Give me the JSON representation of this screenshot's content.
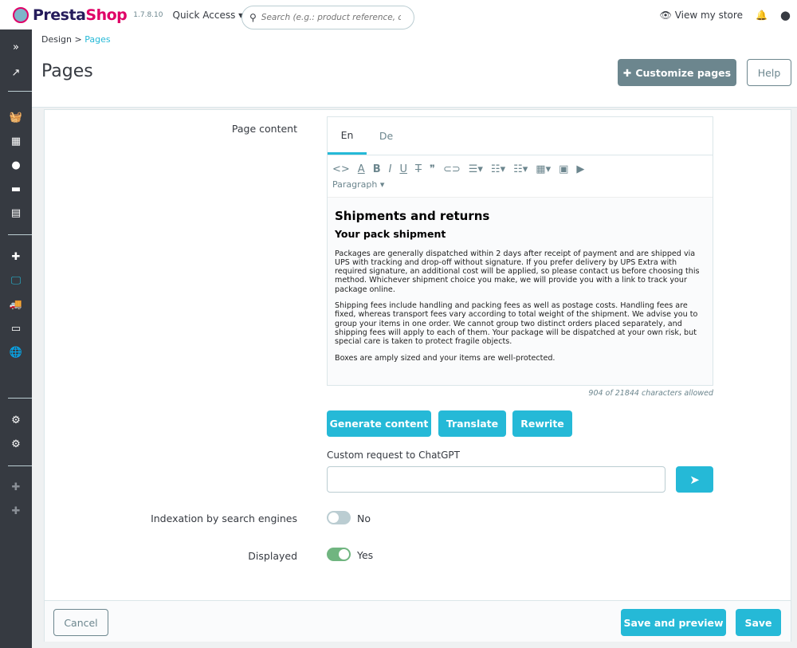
{
  "topbar": {
    "brand_a": "Presta",
    "brand_b": "Shop",
    "version": "1.7.8.10",
    "quick_access": "Quick Access",
    "search_placeholder": "Search (e.g.: product reference, custon",
    "view_store": "View my store"
  },
  "sidebar": {
    "items": [
      "expand",
      "stats",
      "orders",
      "catalog",
      "customers",
      "messages",
      "reports",
      "modules",
      "design",
      "shipping",
      "payment",
      "international",
      "settings",
      "advanced",
      "module-a",
      "module-b"
    ],
    "active": "design"
  },
  "breadcrumb": {
    "parent": "Design",
    "current": "Pages"
  },
  "page_title": "Pages",
  "header_buttons": {
    "customize": "Customize pages",
    "help": "Help"
  },
  "form": {
    "page_content_label": "Page content",
    "lang_tabs": [
      "En",
      "De"
    ],
    "paragraph_label": "Paragraph",
    "content": {
      "h2": "Shipments and returns",
      "h3": "Your pack shipment",
      "paragraphs": [
        "Packages are generally dispatched within 2 days after receipt of payment and are shipped via UPS with tracking and drop-off without signature. If you prefer delivery by UPS Extra with required signature, an additional cost will be applied, so please contact us before choosing this method. Whichever shipment choice you make, we will provide you with a link to track your package online.",
        "Shipping fees include handling and packing fees as well as postage costs. Handling fees are fixed, whereas transport fees vary according to total weight of the shipment. We advise you to group your items in one order. We cannot group two distinct orders placed separately, and shipping fees will apply to each of them. Your package will be dispatched at your own risk, but special care is taken to protect fragile objects.",
        "Boxes are amply sized and your items are well-protected."
      ]
    },
    "char_count": "904 of 21844 characters allowed",
    "ai_buttons": [
      "Generate content",
      "Translate",
      "Rewrite"
    ],
    "custom_request_label": "Custom request to ChatGPT",
    "custom_request_value": "",
    "indexation_label": "Indexation by search engines",
    "indexation_value": "No",
    "displayed_label": "Displayed",
    "displayed_value": "Yes"
  },
  "footer": {
    "cancel": "Cancel",
    "save_preview": "Save and preview",
    "save": "Save"
  },
  "colors": {
    "accent": "#25b9d7",
    "sidebar": "#363a41",
    "toggle_on": "#70b580",
    "toggle_off": "#bbcdd2",
    "secondary_btn": "#6c868e"
  }
}
